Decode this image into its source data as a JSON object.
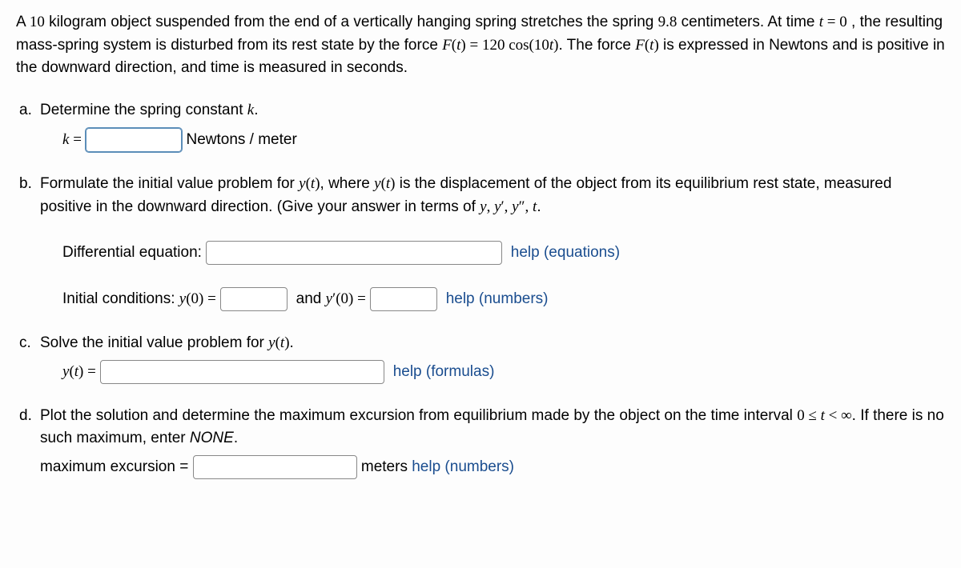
{
  "intro": {
    "t1": "A ",
    "mass": "10",
    "t2": " kilogram object suspended from the end of a vertically hanging spring stretches the spring ",
    "stretch": "9.8",
    "t3": " centimeters. At time ",
    "tcond": "t = 0",
    "t4": " , the resulting mass-spring system is disturbed from its rest state by the force ",
    "force": "F(t) = 120 cos(10t)",
    "t5": ". The force ",
    "ft": "F(t)",
    "t6": " is expressed in Newtons and is positive in the downward direction, and time is measured in seconds."
  },
  "partA": {
    "marker": "a.",
    "text": "Determine the spring constant ",
    "kvar": "k",
    "period": ".",
    "keq": "k =",
    "units": "Newtons / meter"
  },
  "partB": {
    "marker": "b.",
    "t1": "Formulate the initial value problem for ",
    "yt": "y(t)",
    "t2": ", where ",
    "t3": " is the displacement of the object from its equilibrium rest state, measured positive in the downward direction. (Give your answer in terms of ",
    "vars": "y, y′, y″, t",
    "period": ".",
    "de_label": "Differential equation:",
    "help_eq": "help (equations)",
    "ic_label": "Initial conditions: ",
    "y0": "y(0) =",
    "and": "and ",
    "yp0": "y′(0) =",
    "help_num": "help (numbers)"
  },
  "partC": {
    "marker": "c.",
    "text": "Solve the initial value problem for ",
    "yt": "y(t)",
    "period": ".",
    "yteq": "y(t) =",
    "help": "help (formulas)"
  },
  "partD": {
    "marker": "d.",
    "t1": "Plot the solution and determine the maximum excursion from equilibrium made by the object on the time interval ",
    "interval": "0 ≤ t < ∞",
    "t2": ". If there is no such maximum, enter ",
    "none": "NONE",
    "period": ".",
    "label": "maximum excursion =",
    "units": "meters ",
    "help": "help (numbers)"
  }
}
